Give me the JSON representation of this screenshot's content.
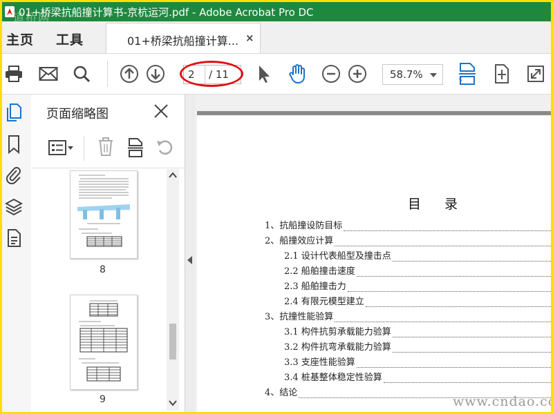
{
  "window": {
    "title": "01+桥梁抗船撞计算书-京杭运河.pdf - Adobe Acrobat Pro DC"
  },
  "menu": {
    "home": "主页",
    "tools": "工具"
  },
  "tab": {
    "label": "01+桥梁抗船撞计算...",
    "close": "×"
  },
  "toolbar": {
    "page_current": "2",
    "page_total": "/ 11",
    "zoom": "58.7%"
  },
  "panel": {
    "title": "页面缩略图",
    "thumbnails": [
      {
        "label": "8"
      },
      {
        "label": "9"
      }
    ]
  },
  "document": {
    "toc_title": "目 录",
    "toc": [
      {
        "text": "1、抗船撞设防目标",
        "level": 1
      },
      {
        "text": "2、船撞效应计算",
        "level": 1
      },
      {
        "text": "2.1 设计代表船型及撞击点",
        "level": 2
      },
      {
        "text": "2.2 船舶撞击速度",
        "level": 2
      },
      {
        "text": "2.3 船舶撞击力",
        "level": 2
      },
      {
        "text": "2.4 有限元模型建立",
        "level": 2
      },
      {
        "text": "3、抗撞性能验算",
        "level": 1
      },
      {
        "text": "3.1 构件抗剪承载能力验算",
        "level": 2
      },
      {
        "text": "3.2 构件抗弯承载能力验算",
        "level": 2
      },
      {
        "text": "3.3 支座性能验算",
        "level": 2
      },
      {
        "text": "3.4 桩基整体稳定性验算",
        "level": 2
      },
      {
        "text": "4、结论",
        "level": 1
      }
    ]
  },
  "watermarks": {
    "top_left": "道桥网",
    "bottom_right": "www.cndao.com"
  },
  "colors": {
    "titlebar": "#1f883f",
    "frame": "#ffde00",
    "accent_blue": "#1a73c7",
    "annotation_red": "#e10f12"
  }
}
